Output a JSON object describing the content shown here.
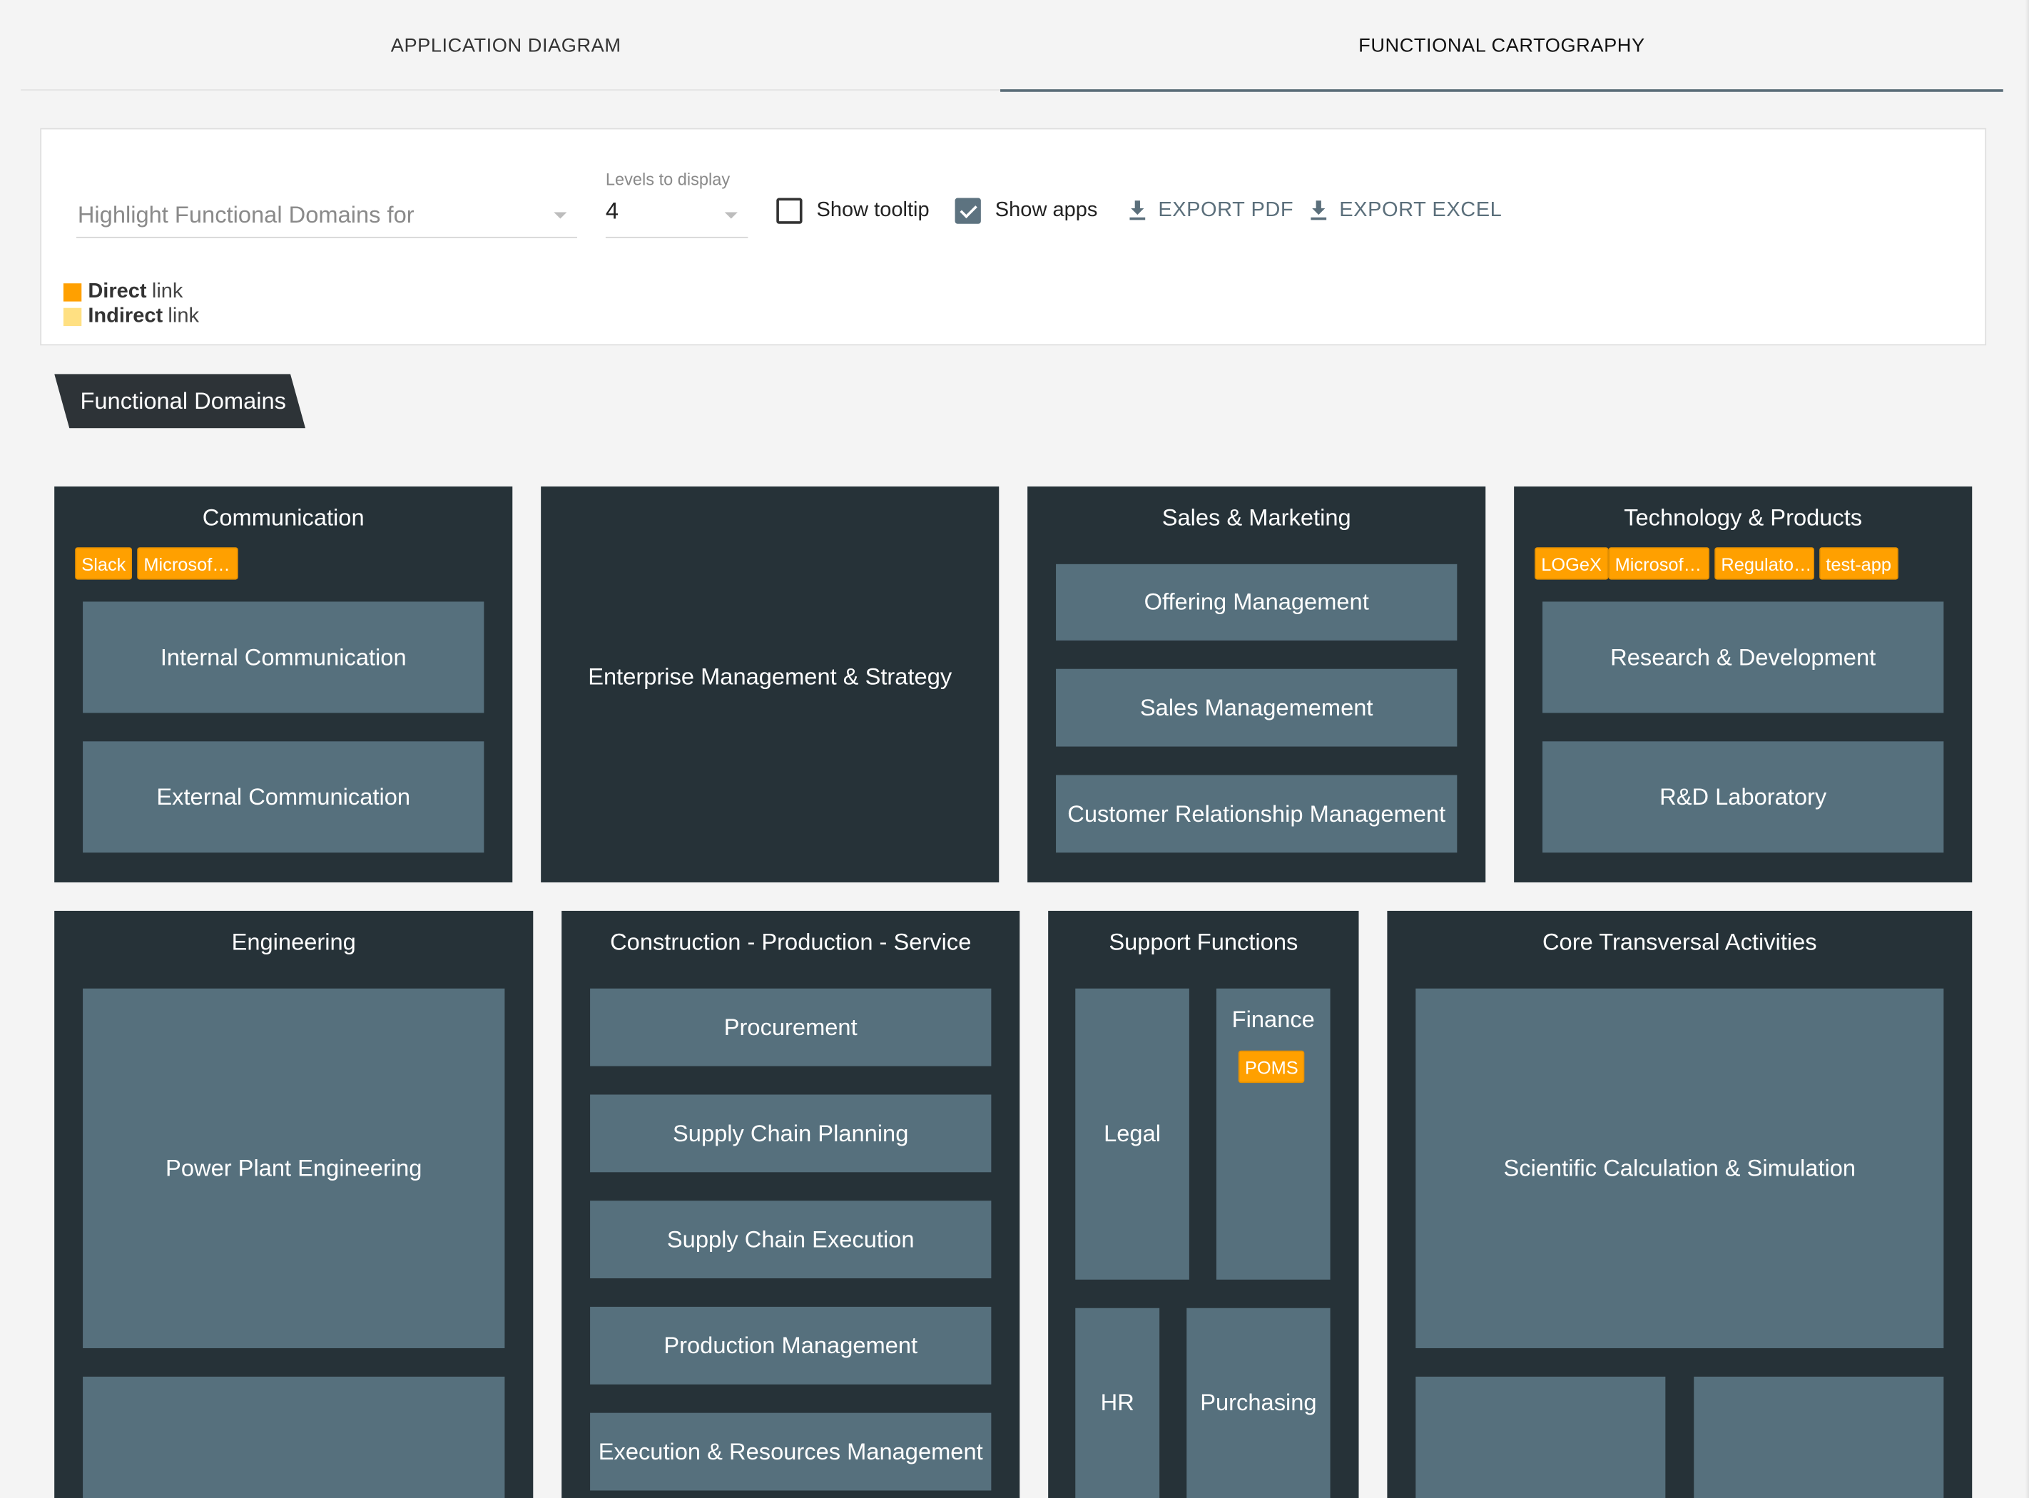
{
  "tabs": [
    {
      "label": "APPLICATION DIAGRAM",
      "active": false
    },
    {
      "label": "FUNCTIONAL CARTOGRAPHY",
      "active": true
    }
  ],
  "toolbar": {
    "highlight_placeholder": "Highlight Functional Domains for",
    "levels_label": "Levels to display",
    "levels_value": "4",
    "show_tooltip_label": "Show tooltip",
    "show_tooltip_checked": false,
    "show_apps_label": "Show apps",
    "show_apps_checked": true,
    "export_pdf_label": "EXPORT PDF",
    "export_excel_label": "EXPORT EXCEL"
  },
  "legend": {
    "direct_bold": "Direct",
    "direct_rest": "link",
    "direct_color": "#ffa000",
    "indirect_bold": "Indirect",
    "indirect_rest": "link",
    "indirect_color": "#ffe082"
  },
  "section_label": "Functional Domains",
  "domains": {
    "communication": {
      "title": "Communication",
      "apps": [
        "Slack",
        "Microsof…"
      ],
      "subs": [
        "Internal Communication",
        "External Communication"
      ]
    },
    "enterprise": {
      "title": "Enterprise Management & Strategy"
    },
    "sales": {
      "title": "Sales & Marketing",
      "subs": [
        "Offering Management",
        "Sales Managemement",
        "Customer Relationship Management"
      ]
    },
    "technology": {
      "title": "Technology & Products",
      "apps": [
        "LOGeX",
        "Microsof…",
        "Regulato…",
        "test-app"
      ],
      "subs": [
        "Research & Development",
        "R&D Laboratory"
      ]
    },
    "engineering": {
      "title": "Engineering",
      "subs": [
        "Power Plant Engineering"
      ]
    },
    "construction": {
      "title": "Construction - Production - Service",
      "subs": [
        "Procurement",
        "Supply Chain Planning",
        "Supply Chain Execution",
        "Production Management",
        "Execution & Resources Management"
      ]
    },
    "support": {
      "title": "Support Functions",
      "subs": [
        "Legal",
        "Finance",
        "HR",
        "Purchasing"
      ],
      "finance_apps": [
        "POMS"
      ]
    },
    "core": {
      "title": "Core Transversal Activities",
      "subs": [
        "Scientific Calculation & Simulation"
      ]
    }
  },
  "colors": {
    "domain_bg": "#263238",
    "sub_bg": "#56707d",
    "app_chip": "#ffa000",
    "accent": "#5d7380"
  },
  "icons": [
    "download-icon",
    "checkbox-icon",
    "caret-down-icon"
  ]
}
